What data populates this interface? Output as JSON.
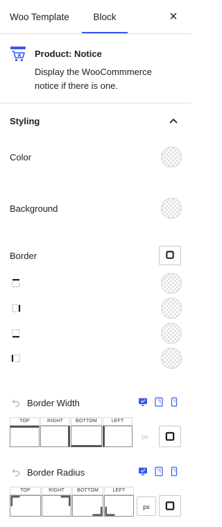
{
  "tabs": {
    "woo_template": "Woo Template",
    "block": "Block",
    "active": "Block"
  },
  "close_icon": "×",
  "block": {
    "icon": "cart-notice-icon",
    "title": "Product: Notice",
    "description": "Display the WooCommmerce notice if there is one."
  },
  "styling": {
    "title": "Styling",
    "expanded": true,
    "color_label": "Color",
    "background_label": "Background",
    "border_label": "Border",
    "border_sides": [
      "top",
      "right",
      "bottom",
      "left"
    ]
  },
  "border_width": {
    "title": "Border Width",
    "sides": [
      "TOP",
      "RIGHT",
      "BOTTOM",
      "LEFT"
    ],
    "unit": "px",
    "active_device": "desktop"
  },
  "border_radius": {
    "title": "Border Radius",
    "sides": [
      "TOP",
      "RIGHT",
      "BOTTOM",
      "LEFT"
    ],
    "unit": "px",
    "active_device": "desktop"
  },
  "colors": {
    "accent": "#3858e9",
    "text": "#1e1e1e",
    "divider": "#e0e0e0"
  }
}
